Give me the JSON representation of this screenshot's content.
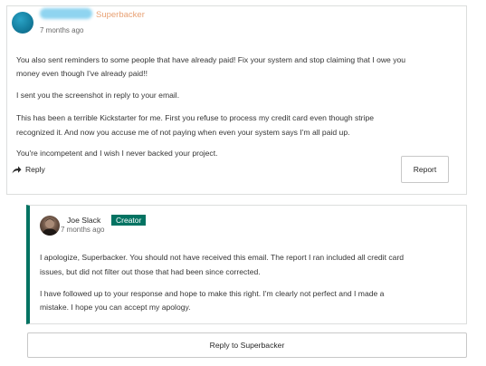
{
  "comment": {
    "author_badge": "Superbacker",
    "timestamp": "7 months ago",
    "paragraphs": [
      "You also sent reminders to some people that have already paid! Fix your system and stop claiming that I owe you",
      "money even though I've already paid!!",
      "I sent you the screenshot in reply to your email.",
      "This has been a terrible Kickstarter for me. First you refuse to process my credit card even though stripe",
      "recognized it. And now you accuse me of not paying when even your system says I'm all paid up.",
      "You're incompetent and I wish I never backed your project."
    ],
    "reply_label": "Reply",
    "report_label": "Report",
    "colors": {
      "badge": "#e8a174",
      "avatar": "#157fa0"
    }
  },
  "reply": {
    "author_name": "Joe Slack",
    "creator_badge": "Creator",
    "timestamp": "7 months ago",
    "paragraphs": [
      "I apologize, Superbacker. You should not have received this email. The report I ran included all credit card",
      "issues, but did not filter out those that had been since corrected.",
      "I have followed up to your response and hope to make this right. I'm clearly not perfect and I made a",
      "mistake. I hope you can accept my apology."
    ],
    "colors": {
      "accent": "#037362"
    }
  },
  "footer": {
    "reply_to_label": "Reply to Superbacker"
  }
}
